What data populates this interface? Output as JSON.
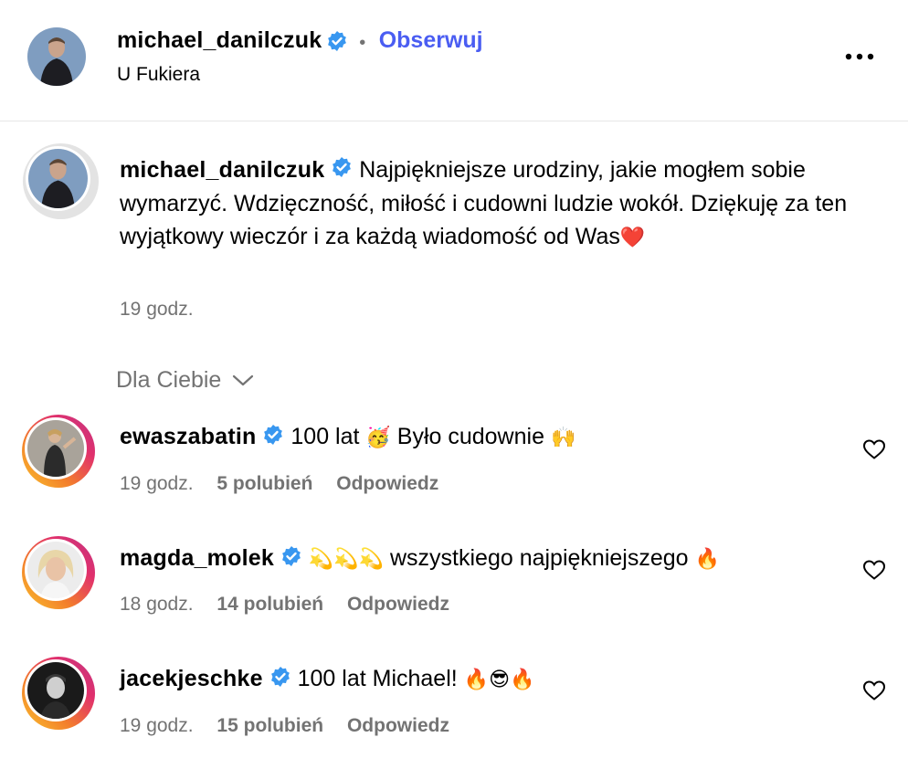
{
  "header": {
    "username": "michael_danilczuk",
    "separator": "•",
    "follow_label": "Obserwuj",
    "location": "U Fukiera",
    "more_icon": "more-horizontal-icon"
  },
  "post": {
    "username": "michael_danilczuk",
    "caption": "Najpiękniejsze urodziny, jakie mogłem sobie wymarzyć. Wdzięczność, miłość i cudowni ludzie wokół. Dziękuję za ten wyjątkowy wieczór i za każdą wiadomość od Was",
    "caption_emoji": "❤️",
    "time": "19 godz."
  },
  "filter": {
    "label": "Dla Ciebie"
  },
  "comments": [
    {
      "username": "ewaszabatin",
      "text_a": "100 lat",
      "emoji_a": "🥳",
      "text_b": "Było cudownie",
      "emoji_b": "🙌",
      "time": "19 godz.",
      "likes": "5 polubień",
      "reply": "Odpowiedz"
    },
    {
      "username": "magda_molek",
      "emoji_a": "💫💫💫",
      "text_a": "wszystkiego najpiękniejszego",
      "emoji_b": "🔥",
      "time": "18 godz.",
      "likes": "14 polubień",
      "reply": "Odpowiedz"
    },
    {
      "username": "jacekjeschke",
      "text_a": "100 lat Michael!",
      "emoji_a": "🔥😎🔥",
      "time": "19 godz.",
      "likes": "15 polubień",
      "reply": "Odpowiedz"
    }
  ],
  "colors": {
    "verified": "#3897f0",
    "follow": "#4a5df2",
    "muted": "#737373",
    "divider": "#e6e6e6"
  }
}
